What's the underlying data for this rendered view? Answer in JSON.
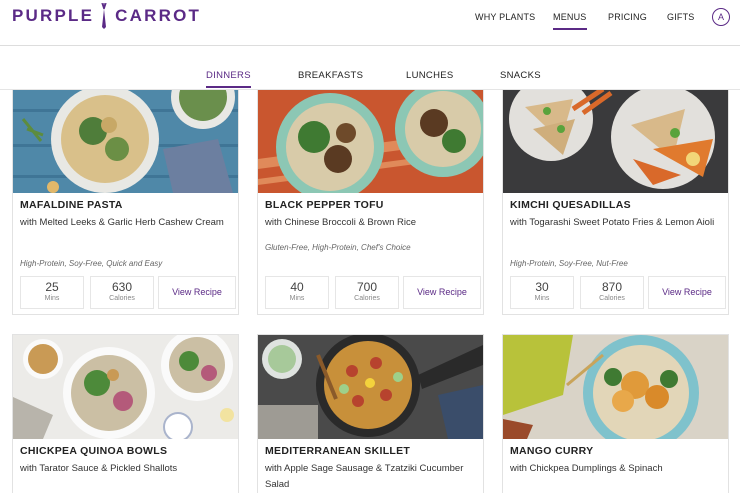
{
  "brand": {
    "left": "PURPLE",
    "right": "CARROT",
    "color": "#5b2a86"
  },
  "nav": {
    "why_plants": "WHY PLANTS",
    "menus": "MENUS",
    "pricing": "PRICING",
    "gifts": "GIFTS",
    "account_initial": "A"
  },
  "tabs": {
    "dinners": "DINNERS",
    "breakfasts": "BREAKFASTS",
    "lunches": "LUNCHES",
    "snacks": "SNACKS"
  },
  "stat_labels": {
    "mins": "Mins",
    "calories": "Calories"
  },
  "view_recipe_label": "View Recipe",
  "recipes": [
    {
      "name": "MAFALDINE PASTA",
      "subtitle": "with Melted Leeks & Garlic Herb Cashew Cream",
      "tags": "High-Protein, Soy-Free, Quick and Easy",
      "mins": "25",
      "calories": "630"
    },
    {
      "name": "BLACK PEPPER TOFU",
      "subtitle": "with Chinese Broccoli & Brown Rice",
      "tags": "Gluten-Free, High-Protein, Chef's Choice",
      "mins": "40",
      "calories": "700"
    },
    {
      "name": "KIMCHI QUESADILLAS",
      "subtitle": "with Togarashi Sweet Potato Fries & Lemon Aioli",
      "tags": "High-Protein, Soy-Free, Nut-Free",
      "mins": "30",
      "calories": "870"
    },
    {
      "name": "CHICKPEA QUINOA BOWLS",
      "subtitle": "with Tarator Sauce & Pickled Shallots"
    },
    {
      "name": "MEDITERRANEAN SKILLET",
      "subtitle": "with Apple Sage Sausage & Tzatziki Cucumber Salad"
    },
    {
      "name": "MANGO CURRY",
      "subtitle": "with Chickpea Dumplings & Spinach"
    }
  ]
}
